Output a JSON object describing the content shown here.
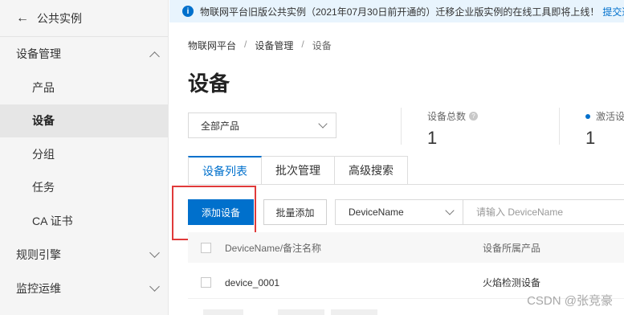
{
  "sidebar": {
    "back_label": "公共实例",
    "groups": [
      {
        "label": "设备管理",
        "expanded": true
      },
      {
        "label": "规则引擎",
        "expanded": false
      },
      {
        "label": "监控运维",
        "expanded": false
      }
    ],
    "items": [
      {
        "label": "产品",
        "active": false
      },
      {
        "label": "设备",
        "active": true
      },
      {
        "label": "分组",
        "active": false
      },
      {
        "label": "任务",
        "active": false
      },
      {
        "label": "CA 证书",
        "active": false
      }
    ]
  },
  "notice": {
    "text": "物联网平台旧版公共实例（2021年07月30日前开通的）迁移企业版实例的在线工具即将上线！",
    "link": "提交迁"
  },
  "breadcrumb": [
    "物联网平台",
    "设备管理",
    "设备"
  ],
  "page_title": "设备",
  "product_filter": {
    "selected": "全部产品"
  },
  "stats": {
    "total": {
      "label": "设备总数",
      "value": "1"
    },
    "active": {
      "label": "激活设",
      "value": "1"
    }
  },
  "tabs": [
    {
      "label": "设备列表",
      "active": true
    },
    {
      "label": "批次管理",
      "active": false
    },
    {
      "label": "高级搜索",
      "active": false
    }
  ],
  "toolbar": {
    "add_label": "添加设备",
    "batch_label": "批量添加",
    "field_selected": "DeviceName",
    "search_placeholder": "请输入 DeviceName"
  },
  "table": {
    "columns": [
      "DeviceName/备注名称",
      "设备所属产品"
    ],
    "rows": [
      {
        "name": "device_0001",
        "product": "火焰检测设备"
      }
    ]
  },
  "watermark": "CSDN @张竞豪",
  "colors": {
    "accent": "#0070cc",
    "highlight": "#e03a3a",
    "notice_bg": "#e8f4fd"
  }
}
